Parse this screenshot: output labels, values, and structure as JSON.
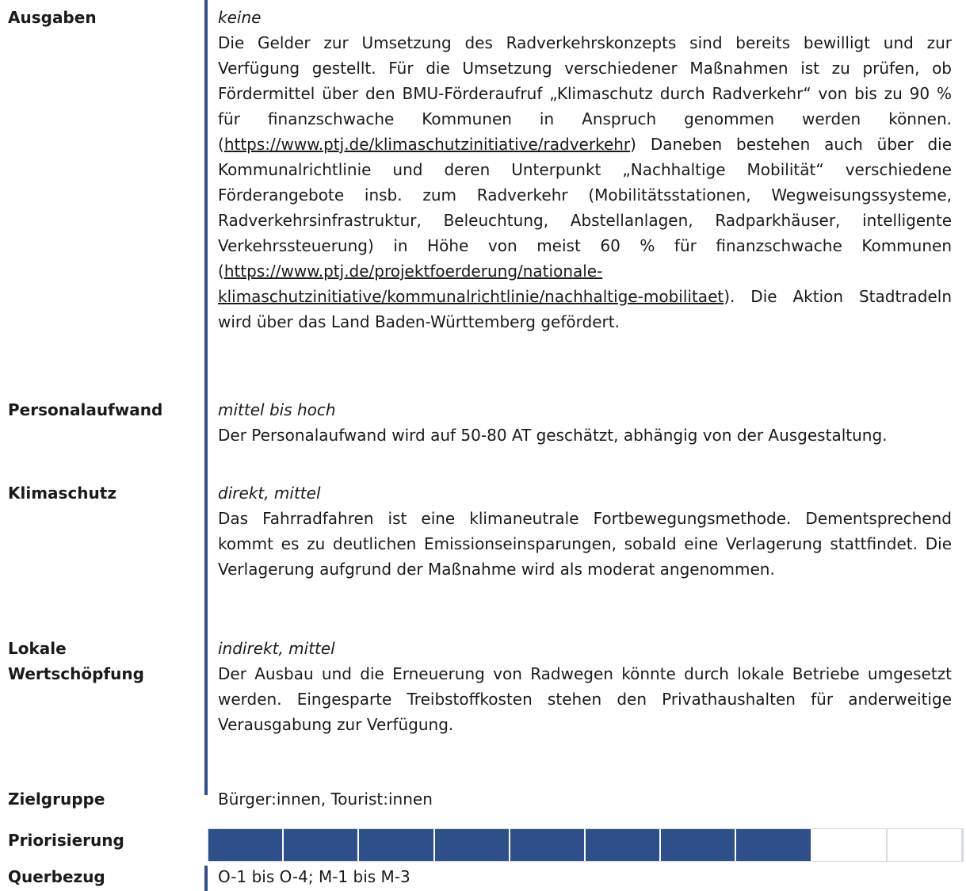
{
  "rows": {
    "ausgaben": {
      "label": "Ausgaben",
      "rating": "keine",
      "text_1": "Die Gelder zur Umsetzung des Radverkehrskonzepts sind bereits bewilligt und zur Verfügung gestellt. Für die Umsetzung verschiedener Maßnahmen ist zu prüfen, ob Fördermittel über den BMU-Förderaufruf „Klimaschutz durch Radverkehr“ von bis zu 90 % für finanzschwache Kommunen in Anspruch genommen werden können. (",
      "link_1": "https://www.ptj.de/klimaschutzinitiative/radverkehr",
      "text_2": ") Daneben bestehen auch über die Kommunalrichtlinie und deren Unterpunkt „Nachhaltige Mobilität“ verschiedene Förderangebote insb. zum Radverkehr (Mobilitätsstationen, Wegweisungssysteme, Radverkehrsinfrastruktur, Beleuchtung, Abstellanlagen, Radparkhäuser, intelligente Verkehrssteuerung) in Höhe von meist 60 % für finanzschwache Kommunen (",
      "link_2": "https://www.ptj.de/projektfoerderung/nationale-klimaschutzinitiative/kommunalrichtlinie/nachhaltige-mobilitaet",
      "text_3": "). Die Aktion Stadtradeln wird über das Land Baden-Württemberg gefördert."
    },
    "personalaufwand": {
      "label": "Personalaufwand",
      "rating": "mittel bis hoch",
      "text": "Der Personalaufwand wird auf 50-80 AT geschätzt, abhängig von der Ausgestaltung."
    },
    "klimaschutz": {
      "label": "Klimaschutz",
      "rating": "direkt, mittel",
      "text": "Das Fahrradfahren ist eine klimaneutrale Fortbewegungsmethode. Dementsprechend kommt es zu deutlichen Emissionseinsparungen, sobald eine Verlagerung stattfindet. Die Verlagerung aufgrund der Maßnahme wird als moderat angenommen."
    },
    "wertschoepfung": {
      "label_1": "Lokale",
      "label_2": "Wertschöpfung",
      "rating": "indirekt, mittel",
      "text": "Der Ausbau und die Erneuerung von Radwegen könnte durch lokale Betriebe umgesetzt werden. Eingesparte Treibstoffkosten stehen den Privathaushalten für anderweitige Verausgabung zur Verfügung."
    },
    "zielgruppe": {
      "label": "Zielgruppe",
      "text": "Bürger:innen, Tourist:innen"
    },
    "priorisierung": {
      "label": "Priorisierung",
      "filled": 8,
      "total": 10,
      "fill_color": "#2e4f8a"
    },
    "querbezug": {
      "label": "Querbezug",
      "text": "O-1 bis O-4; M-1 bis M-3"
    }
  }
}
